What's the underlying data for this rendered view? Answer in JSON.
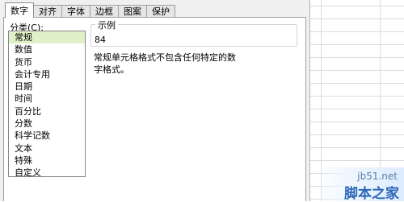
{
  "tabs": [
    "数字",
    "对齐",
    "字体",
    "边框",
    "图案",
    "保护"
  ],
  "category": {
    "label": "分类(C):",
    "items": [
      "常规",
      "数值",
      "货币",
      "会计专用",
      "日期",
      "时间",
      "百分比",
      "分数",
      "科学记数",
      "文本",
      "特殊",
      "自定义"
    ],
    "selected": "常规"
  },
  "sample": {
    "title": "示例",
    "value": "84"
  },
  "description": "常规单元格格式不包含任何特定的数字格式。",
  "watermark": {
    "url": "jb51.net",
    "name": "脚本之家"
  },
  "colors": {
    "selected_bg": "#e1f1c7",
    "watermark": "#2c67b8"
  }
}
